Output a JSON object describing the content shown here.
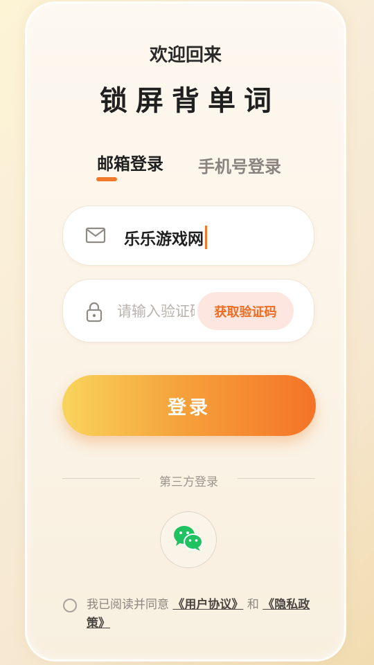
{
  "header": {
    "welcome": "欢迎回来",
    "app_title": "锁屏背单词"
  },
  "tabs": [
    {
      "label": "邮箱登录",
      "active": true
    },
    {
      "label": "手机号登录",
      "active": false
    }
  ],
  "email_field": {
    "value": "乐乐游戏网",
    "icon": "mail-icon"
  },
  "code_field": {
    "placeholder": "请输入验证码",
    "icon": "lock-icon",
    "get_code_label": "获取验证码"
  },
  "login_button": {
    "label": "登录"
  },
  "third_party": {
    "label": "第三方登录",
    "providers": [
      {
        "name": "wechat",
        "icon": "wechat-icon"
      }
    ]
  },
  "agreement": {
    "prefix": "我已阅读并同意",
    "user_agreement": "《用户协议》",
    "conjunction": "和",
    "privacy_policy": "《隐私政策》",
    "checked": false
  },
  "colors": {
    "accent": "#f07a2a",
    "gradient_start": "#f8d45c",
    "gradient_end": "#f47327",
    "wechat_green": "#1fc160"
  }
}
